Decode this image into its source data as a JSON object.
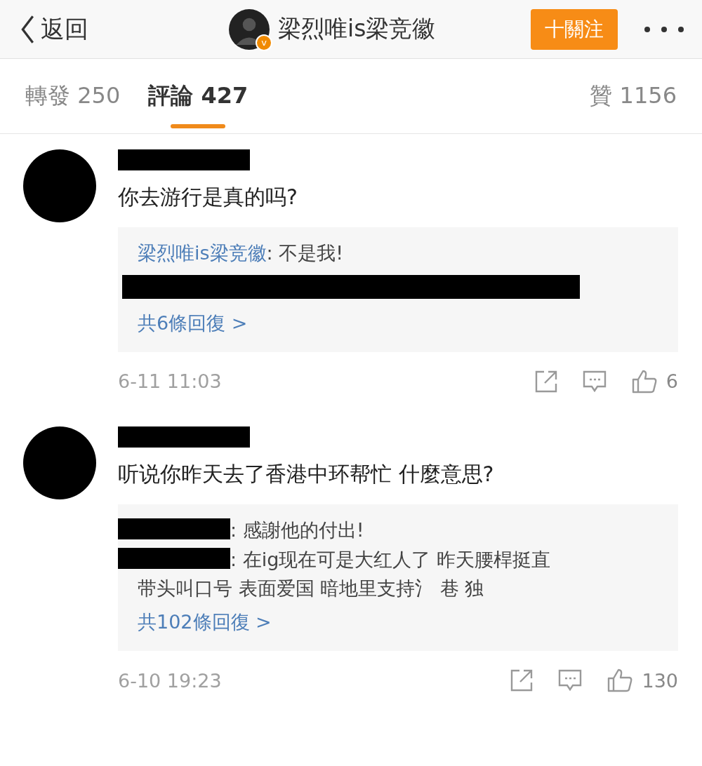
{
  "header": {
    "back_label": "返回",
    "title": "梁烈唯is梁竞徽",
    "badge": "v",
    "follow_button": "十關注"
  },
  "tabs": [
    {
      "label": "轉發",
      "count": "250",
      "selected": false
    },
    {
      "label": "評論",
      "count": "427",
      "selected": true
    }
  ],
  "likes": {
    "label": "贊",
    "count": "1156"
  },
  "comments": [
    {
      "text": "你去游行是真的吗?",
      "replies": [
        {
          "kind": "named",
          "author": "梁烈唯is梁竞徽",
          "text": ": 不是我!"
        },
        {
          "kind": "redacted"
        }
      ],
      "more_replies": "共6條回復 >",
      "time": "6-11 11:03",
      "like_count": "6"
    },
    {
      "text": "听说你昨天去了香港中环帮忙 什麼意思?",
      "replies": [
        {
          "kind": "redacted_author",
          "lines": [
            ": 感謝他的付出!"
          ]
        },
        {
          "kind": "redacted_author",
          "lines": [
            ": 在ig现在可是大红人了 昨天腰桿挺直",
            "带头叫口号 表面爱国 暗地里支持氵 巷 独"
          ]
        }
      ],
      "more_replies": "共102條回復 >",
      "time": "6-10 19:23",
      "like_count": "130"
    }
  ]
}
